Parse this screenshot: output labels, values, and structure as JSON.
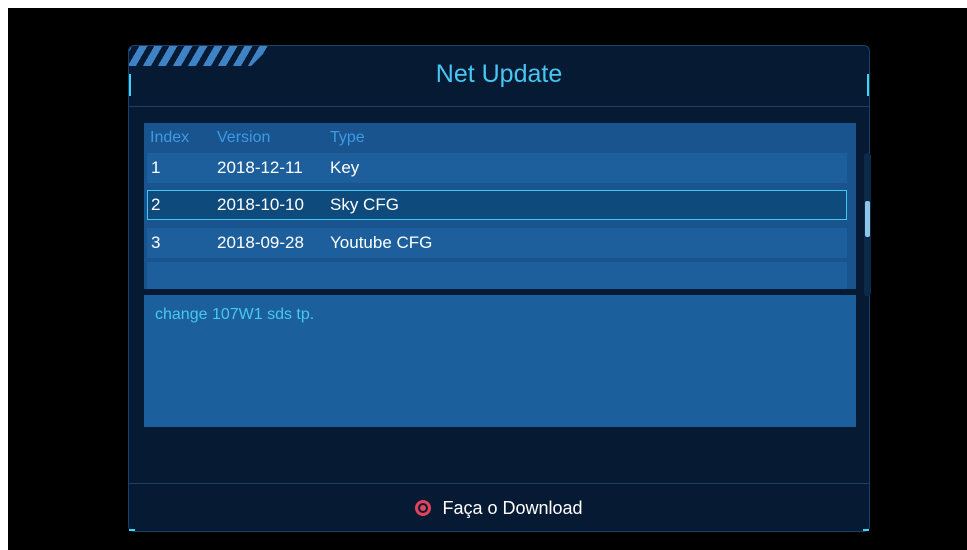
{
  "title": "Net Update",
  "table": {
    "headers": {
      "index": "Index",
      "version": "Version",
      "type": "Type"
    },
    "rows": [
      {
        "index": "1",
        "version": "2018-12-11",
        "type": "Key"
      },
      {
        "index": "2",
        "version": "2018-10-10",
        "type": "Sky CFG"
      },
      {
        "index": "3",
        "version": "2018-09-28",
        "type": "Youtube CFG"
      }
    ],
    "selected_row": 2
  },
  "description": "change 107W1 sds tp.",
  "footer": {
    "icon": "ok-button-icon",
    "label": "Faça o Download"
  },
  "colors": {
    "background": "#071a33",
    "title": "#46c6f3",
    "panel": "#19548e",
    "selection_border": "#3fc9ee",
    "ok_icon": "#e0435a"
  }
}
